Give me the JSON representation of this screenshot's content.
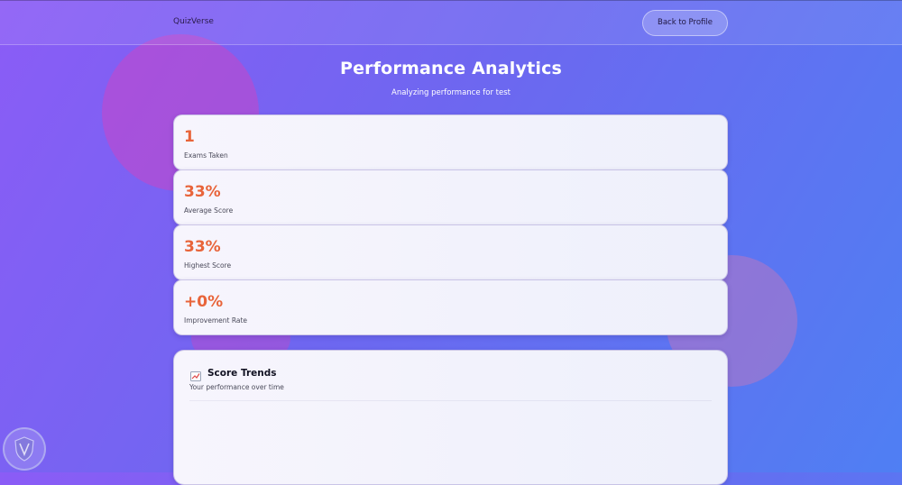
{
  "header": {
    "brand": "QuizVerse",
    "back_label": "Back to Profile"
  },
  "page": {
    "title": "Performance Analytics",
    "subtitle": "Analyzing performance for test"
  },
  "stats": [
    {
      "value": "1",
      "label": "Exams Taken"
    },
    {
      "value": "33%",
      "label": "Average Score"
    },
    {
      "value": "33%",
      "label": "Highest Score"
    },
    {
      "value": "+0%",
      "label": "Improvement Rate"
    }
  ],
  "trends": {
    "icon": "chart-increasing-icon",
    "title": "Score Trends",
    "subtitle": "Your performance over time"
  },
  "colors": {
    "accent": "#e8643a",
    "bg_start": "#8b5cf6",
    "bg_end": "#4f7ff3"
  }
}
